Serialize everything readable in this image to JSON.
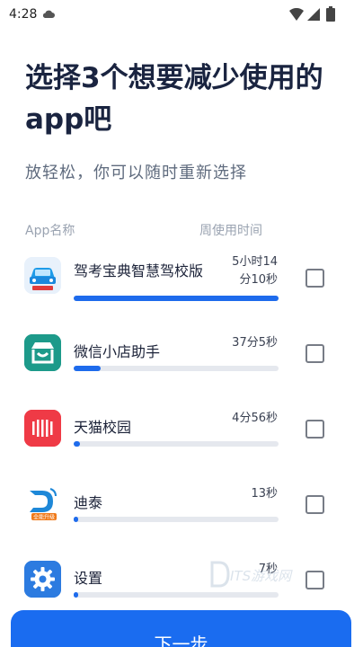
{
  "status_bar": {
    "time": "4:28",
    "icons": [
      "cloud-icon",
      "wifi-icon",
      "signal-icon",
      "battery-icon"
    ]
  },
  "header": {
    "title": "选择3个想要减少使用的app吧",
    "subtitle": "放轻松，你可以随时重新选择"
  },
  "columns": {
    "app": "App名称",
    "time": "周使用时间"
  },
  "apps": [
    {
      "name": "驾考宝典智慧驾校版",
      "time_line1": "5小时14",
      "time_line2": "分10秒",
      "usage_fraction": 1.0,
      "checked": false,
      "icon": "car-app-icon"
    },
    {
      "name": "微信小店助手",
      "time_line1": "37分5秒",
      "time_line2": "",
      "usage_fraction": 0.13,
      "checked": false,
      "icon": "shop-app-icon"
    },
    {
      "name": "天猫校园",
      "time_line1": "4分56秒",
      "time_line2": "",
      "usage_fraction": 0.03,
      "checked": false,
      "icon": "tmall-app-icon"
    },
    {
      "name": "迪泰",
      "time_line1": "13秒",
      "time_line2": "",
      "usage_fraction": 0.01,
      "checked": false,
      "icon": "ditai-app-icon",
      "icon_badge": "全能升级"
    },
    {
      "name": "设置",
      "time_line1": "7秒",
      "time_line2": "",
      "usage_fraction": 0.01,
      "checked": false,
      "icon": "settings-gear-icon"
    }
  ],
  "watermark": "ITS游戏网",
  "footer": {
    "next_label": "下一步"
  },
  "colors": {
    "accent": "#1a6cf0",
    "bar_track": "#e5e8ee",
    "title": "#1a2440"
  }
}
